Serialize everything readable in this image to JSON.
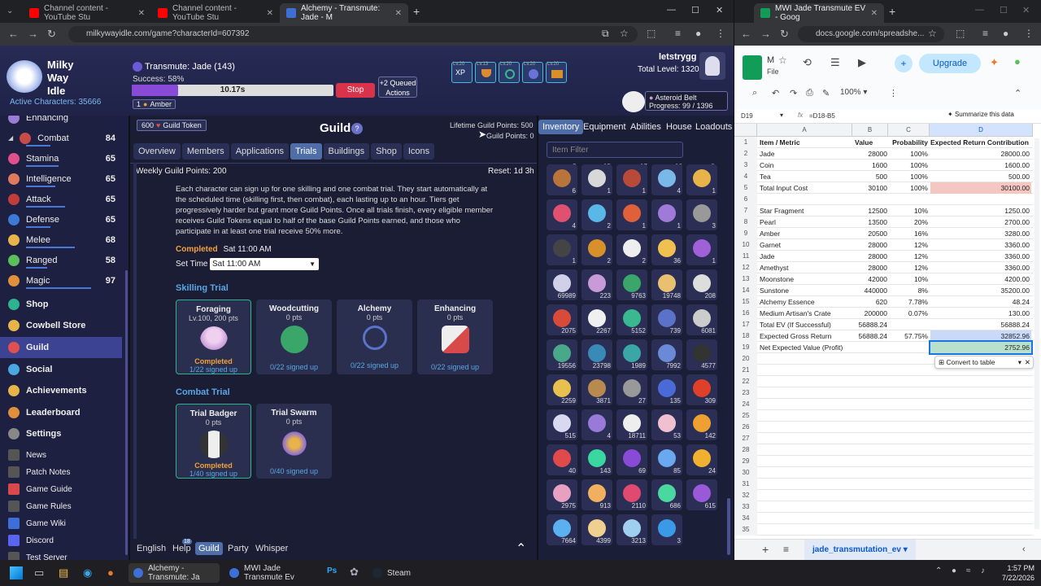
{
  "left_browser": {
    "tabs": [
      {
        "label": "Channel content - YouTube Stu",
        "color": "#ff0000"
      },
      {
        "label": "Channel content - YouTube Stu",
        "color": "#ff0000"
      },
      {
        "label": "Alchemy - Transmute: Jade - M",
        "color": "#3d6fd6"
      }
    ],
    "url": "milkywayidle.com/game?characterId=607392"
  },
  "game": {
    "logo": "Milky Way Idle",
    "active_characters": "Active Characters: 35666",
    "action_title": "Transmute: Jade (143)",
    "success": "Success: 58%",
    "timer": "10.17s",
    "stop": "Stop",
    "queued": "+2 Queued Actions",
    "amber_count": "1",
    "amber_label": "Amber",
    "buff_levels": [
      "Lv.20",
      "Lv.13",
      "Lv.20",
      "Lv.20",
      "Lv.20"
    ],
    "xp_label": "XP",
    "username": "letstrygg",
    "total_level": "Total Level: 1320",
    "location": "Asteroid Belt",
    "progress": "Progress: 99 / 1396"
  },
  "sidebar": {
    "skills": [
      {
        "name": "Enhancing",
        "level": "",
        "color": "#9a7cd6",
        "progress": 0.2
      },
      {
        "name": "Combat",
        "level": "84",
        "color": "#c84b4b",
        "progress": 0.3
      },
      {
        "name": "Stamina",
        "level": "65",
        "color": "#e0508e",
        "progress": 0.4
      },
      {
        "name": "Intelligence",
        "level": "65",
        "color": "#e07a5f",
        "progress": 0.35
      },
      {
        "name": "Attack",
        "level": "65",
        "color": "#c13d3d",
        "progress": 0.45
      },
      {
        "name": "Defense",
        "level": "65",
        "color": "#3d7ad6",
        "progress": 0.3
      },
      {
        "name": "Melee",
        "level": "68",
        "color": "#e8b44a",
        "progress": 0.55
      },
      {
        "name": "Ranged",
        "level": "58",
        "color": "#5bbf5b",
        "progress": 0.25
      },
      {
        "name": "Magic",
        "level": "97",
        "color": "#e0903d",
        "progress": 0.75
      }
    ],
    "nav": [
      {
        "name": "Shop",
        "color": "#2fb28e"
      },
      {
        "name": "Cowbell Store",
        "color": "#e8b44a"
      },
      {
        "name": "Guild",
        "color": "#e05050"
      },
      {
        "name": "Social",
        "color": "#4aa8e0"
      },
      {
        "name": "Achievements",
        "color": "#e8b44a"
      },
      {
        "name": "Leaderboard",
        "color": "#e0903d"
      },
      {
        "name": "Settings",
        "color": "#aaa"
      }
    ],
    "links": [
      "News",
      "Patch Notes",
      "Game Guide",
      "Game Rules",
      "Game Wiki",
      "Discord",
      "Test Server"
    ]
  },
  "guild": {
    "token": "600",
    "token_label": "Guild Token",
    "title": "Guild",
    "help": "?",
    "lifetime": "Lifetime Guild Points: 500",
    "points": "Guild Points: 0",
    "tabs": [
      "Overview",
      "Members",
      "Applications",
      "Trials",
      "Buildings",
      "Shop",
      "Icons"
    ],
    "weekly": "Weekly Guild Points: 200",
    "reset": "Reset: 1d 3h",
    "description": "Each character can sign up for one skilling and one combat trial. They start automatically at the scheduled time (skilling first, then combat), each lasting up to an hour. Tiers get progressively harder but grant more Guild Points. Once all trials finish, every eligible member receives Guild Tokens equal to half of the base Guild Points earned, and those who participate in at least one trial receive 50% more.",
    "completed_label": "Completed",
    "completed_time": "Sat 11:00 AM",
    "set_time_label": "Set Time",
    "set_time_value": "Sat 11:00 AM",
    "skilling_header": "Skilling Trial",
    "combat_header": "Combat Trial",
    "skilling": [
      {
        "name": "Foraging",
        "pts": "Lv.100, 200 pts",
        "status": "Completed",
        "signed": "1/22 signed up",
        "color": "#c89ad8"
      },
      {
        "name": "Woodcutting",
        "pts": "0 pts",
        "status": "",
        "signed": "0/22 signed up",
        "color": "#3aa66a"
      },
      {
        "name": "Alchemy",
        "pts": "0 pts",
        "status": "",
        "signed": "0/22 signed up",
        "color": "#5a72c8"
      },
      {
        "name": "Enhancing",
        "pts": "0 pts",
        "status": "",
        "signed": "0/22 signed up",
        "color": "#d8d8d8"
      }
    ],
    "combat": [
      {
        "name": "Trial Badger",
        "pts": "0 pts",
        "status": "Completed",
        "signed": "1/40 signed up",
        "color": "#bbbbbb"
      },
      {
        "name": "Trial Swarm",
        "pts": "0 pts",
        "status": "",
        "signed": "0/40 signed up",
        "color": "#8a6ad8"
      }
    ]
  },
  "inventory": {
    "tabs": [
      "Inventory",
      "Equipment",
      "Abilities",
      "House",
      "Loadouts"
    ],
    "filter_placeholder": "Item Filter",
    "top_counts": [
      "3",
      "15",
      "17",
      "16",
      "6"
    ],
    "items": [
      {
        "n": "6",
        "c": "#b8743a"
      },
      {
        "n": "1",
        "c": "#d8d8d8"
      },
      {
        "n": "1",
        "c": "#b84a3a"
      },
      {
        "n": "4",
        "c": "#7ab8e8"
      },
      {
        "n": "1",
        "c": "#e8b44a"
      },
      {
        "n": "4",
        "c": "#e05070"
      },
      {
        "n": "2",
        "c": "#5ab8e8"
      },
      {
        "n": "1",
        "c": "#e0603a"
      },
      {
        "n": "1",
        "c": "#a07ad8"
      },
      {
        "n": "3",
        "c": "#999999"
      },
      {
        "n": "1",
        "c": "#444444"
      },
      {
        "n": "2",
        "c": "#d8902a"
      },
      {
        "n": "2",
        "c": "#eeeeee"
      },
      {
        "n": "36",
        "c": "#f0c050"
      },
      {
        "n": "1",
        "c": "#a060d8"
      },
      {
        "n": "69989",
        "c": "#d0d0e8"
      },
      {
        "n": "223",
        "c": "#c89ad8"
      },
      {
        "n": "9763",
        "c": "#3aa66a"
      },
      {
        "n": "19748",
        "c": "#e8c070"
      },
      {
        "n": "208",
        "c": "#dddddd"
      },
      {
        "n": "2075",
        "c": "#d84a3a"
      },
      {
        "n": "2267",
        "c": "#f0f0f0"
      },
      {
        "n": "5152",
        "c": "#3ab890"
      },
      {
        "n": "739",
        "c": "#5a72c8"
      },
      {
        "n": "6081",
        "c": "#cccccc"
      },
      {
        "n": "19556",
        "c": "#4aa88a"
      },
      {
        "n": "23798",
        "c": "#3a8ab8"
      },
      {
        "n": "1989",
        "c": "#3aa6a6"
      },
      {
        "n": "7992",
        "c": "#6a8ad8"
      },
      {
        "n": "4577",
        "c": "#333333"
      },
      {
        "n": "2259",
        "c": "#e8c050"
      },
      {
        "n": "3871",
        "c": "#b88a50"
      },
      {
        "n": "27",
        "c": "#999999"
      },
      {
        "n": "135",
        "c": "#4a6ad8"
      },
      {
        "n": "309",
        "c": "#e0402a"
      },
      {
        "n": "515",
        "c": "#d8d8f0"
      },
      {
        "n": "4",
        "c": "#9a7ad8"
      },
      {
        "n": "18711",
        "c": "#eeeeee"
      },
      {
        "n": "53",
        "c": "#f0c0d0"
      },
      {
        "n": "142",
        "c": "#f0a030"
      },
      {
        "n": "40",
        "c": "#e04a4a"
      },
      {
        "n": "143",
        "c": "#3ad8a0"
      },
      {
        "n": "69",
        "c": "#8a4ad8"
      },
      {
        "n": "85",
        "c": "#6aa8f0"
      },
      {
        "n": "24",
        "c": "#f0b030"
      },
      {
        "n": "2975",
        "c": "#e8a0c0"
      },
      {
        "n": "913",
        "c": "#f0b060"
      },
      {
        "n": "2110",
        "c": "#e04a70"
      },
      {
        "n": "686",
        "c": "#4ad8a0"
      },
      {
        "n": "615",
        "c": "#9a5ad8"
      },
      {
        "n": "7664",
        "c": "#5ab0f0"
      },
      {
        "n": "4399",
        "c": "#f0d090"
      },
      {
        "n": "3213",
        "c": "#a0d0f0"
      },
      {
        "n": "3",
        "c": "#3a9ae8"
      }
    ]
  },
  "chat": {
    "tabs": [
      "English",
      "Help",
      "Guild",
      "Party",
      "Whisper"
    ],
    "help_badge": "18"
  },
  "right_browser": {
    "tab": "MWI Jade Transmute EV - Goog",
    "url": "docs.google.com/spreadshe...",
    "doc_initial": "M",
    "file_menu": "File",
    "upgrade": "Upgrade",
    "zoom": "100%",
    "cell_ref": "D19",
    "formula": "=D18-B5",
    "summarize": "Summarize this data",
    "columns": [
      "A",
      "B",
      "C",
      "D"
    ],
    "convert": "Convert to table",
    "sheet_name": "jade_transmutation_ev",
    "rows": [
      {
        "n": "1",
        "a": "Item / Metric",
        "b": "Value",
        "c": "Probability",
        "d": "Expected Return Contribution",
        "hdr": true
      },
      {
        "n": "2",
        "a": "Jade",
        "b": "28000",
        "c": "100%",
        "d": "28000.00"
      },
      {
        "n": "3",
        "a": "Coin",
        "b": "1600",
        "c": "100%",
        "d": "1600.00"
      },
      {
        "n": "4",
        "a": "Tea",
        "b": "500",
        "c": "100%",
        "d": "500.00"
      },
      {
        "n": "5",
        "a": "Total Input Cost",
        "b": "30100",
        "c": "100%",
        "d": "30100.00",
        "hl": "#f4c7c3"
      },
      {
        "n": "6",
        "a": "",
        "b": "",
        "c": "",
        "d": ""
      },
      {
        "n": "7",
        "a": "Star Fragment",
        "b": "12500",
        "c": "10%",
        "d": "1250.00"
      },
      {
        "n": "8",
        "a": "Pearl",
        "b": "13500",
        "c": "20%",
        "d": "2700.00"
      },
      {
        "n": "9",
        "a": "Amber",
        "b": "20500",
        "c": "16%",
        "d": "3280.00"
      },
      {
        "n": "10",
        "a": "Garnet",
        "b": "28000",
        "c": "12%",
        "d": "3360.00"
      },
      {
        "n": "11",
        "a": "Jade",
        "b": "28000",
        "c": "12%",
        "d": "3360.00"
      },
      {
        "n": "12",
        "a": "Amethyst",
        "b": "28000",
        "c": "12%",
        "d": "3360.00"
      },
      {
        "n": "13",
        "a": "Moonstone",
        "b": "42000",
        "c": "10%",
        "d": "4200.00"
      },
      {
        "n": "14",
        "a": "Sunstone",
        "b": "440000",
        "c": "8%",
        "d": "35200.00"
      },
      {
        "n": "15",
        "a": "Alchemy Essence",
        "b": "620",
        "c": "7.78%",
        "d": "48.24"
      },
      {
        "n": "16",
        "a": "Medium Artisan's Crate",
        "b": "200000",
        "c": "0.07%",
        "d": "130.00"
      },
      {
        "n": "17",
        "a": "Total EV (If Successful)",
        "b": "56888.24",
        "c": "",
        "d": "56888.24"
      },
      {
        "n": "18",
        "a": "Expected Gross Return",
        "b": "56888.24",
        "c": "57.75%",
        "d": "32852.96",
        "hl": "#c9daf8"
      },
      {
        "n": "19",
        "a": "Net Expected Value (Profit)",
        "b": "",
        "c": "",
        "d": "2752.96",
        "hl": "#b7e1cd"
      },
      {
        "n": "20"
      },
      {
        "n": "21"
      },
      {
        "n": "22"
      },
      {
        "n": "23"
      },
      {
        "n": "24"
      },
      {
        "n": "25"
      },
      {
        "n": "26"
      },
      {
        "n": "27"
      },
      {
        "n": "28"
      },
      {
        "n": "29"
      },
      {
        "n": "30"
      },
      {
        "n": "31"
      },
      {
        "n": "32"
      },
      {
        "n": "33"
      },
      {
        "n": "34"
      },
      {
        "n": "35"
      }
    ]
  },
  "taskbar": {
    "items": [
      "Alchemy - Transmute: Ja",
      "MWI Jade Transmute Ev",
      "Steam"
    ],
    "time": "1:57 PM",
    "date": "7/22/2026"
  }
}
